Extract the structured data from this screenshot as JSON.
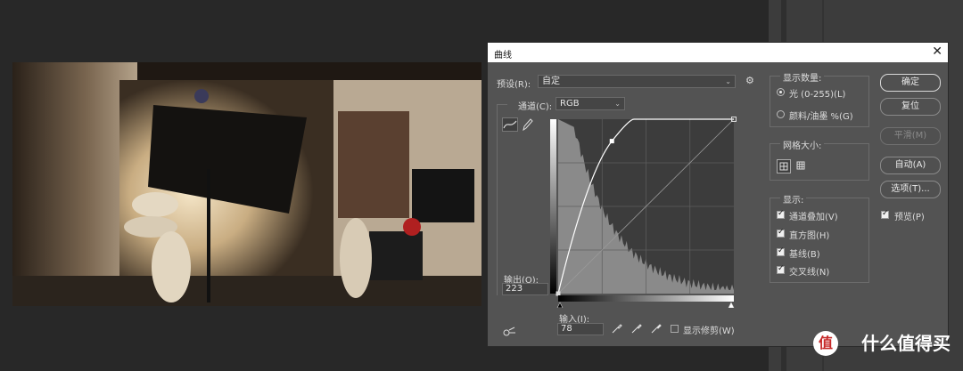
{
  "dialog": {
    "title": "曲线",
    "close_glyph": "✕",
    "preset_label": "预设(R):",
    "preset_value": "自定",
    "channel_label": "通道(C):",
    "channel_value": "RGB",
    "output_label": "输出(O):",
    "output_value": "223",
    "input_label": "输入(I):",
    "input_value": "78",
    "show_clipping_label": "显示修剪(W)",
    "curve": {
      "input": 78,
      "output": 223
    }
  },
  "display_amount": {
    "title": "显示数量:",
    "options": [
      {
        "label": "光 (0-255)(L)",
        "selected": true
      },
      {
        "label": "颜料/油墨 %(G)",
        "selected": false
      }
    ]
  },
  "grid_size": {
    "title": "网格大小:"
  },
  "show": {
    "title": "显示:",
    "items": [
      {
        "label": "通道叠加(V)",
        "checked": true
      },
      {
        "label": "直方图(H)",
        "checked": true
      },
      {
        "label": "基线(B)",
        "checked": true
      },
      {
        "label": "交叉线(N)",
        "checked": true
      }
    ]
  },
  "buttons": {
    "ok": "确定",
    "reset": "复位",
    "smooth": "平滑(M)",
    "auto": "自动(A)",
    "options": "选项(T)..."
  },
  "preview": {
    "label": "预览(P)",
    "checked": true
  },
  "watermark": {
    "logo_glyph": "值",
    "text": "什么值得买"
  },
  "icons": [
    "settings-icon",
    "curve-tool-icon",
    "pencil-icon",
    "grid-4-icon",
    "grid-10-icon",
    "eyedropper-black-icon",
    "eyedropper-gray-icon",
    "eyedropper-white-icon",
    "target-adjust-icon",
    "close-icon",
    "chevron-down-icon"
  ]
}
